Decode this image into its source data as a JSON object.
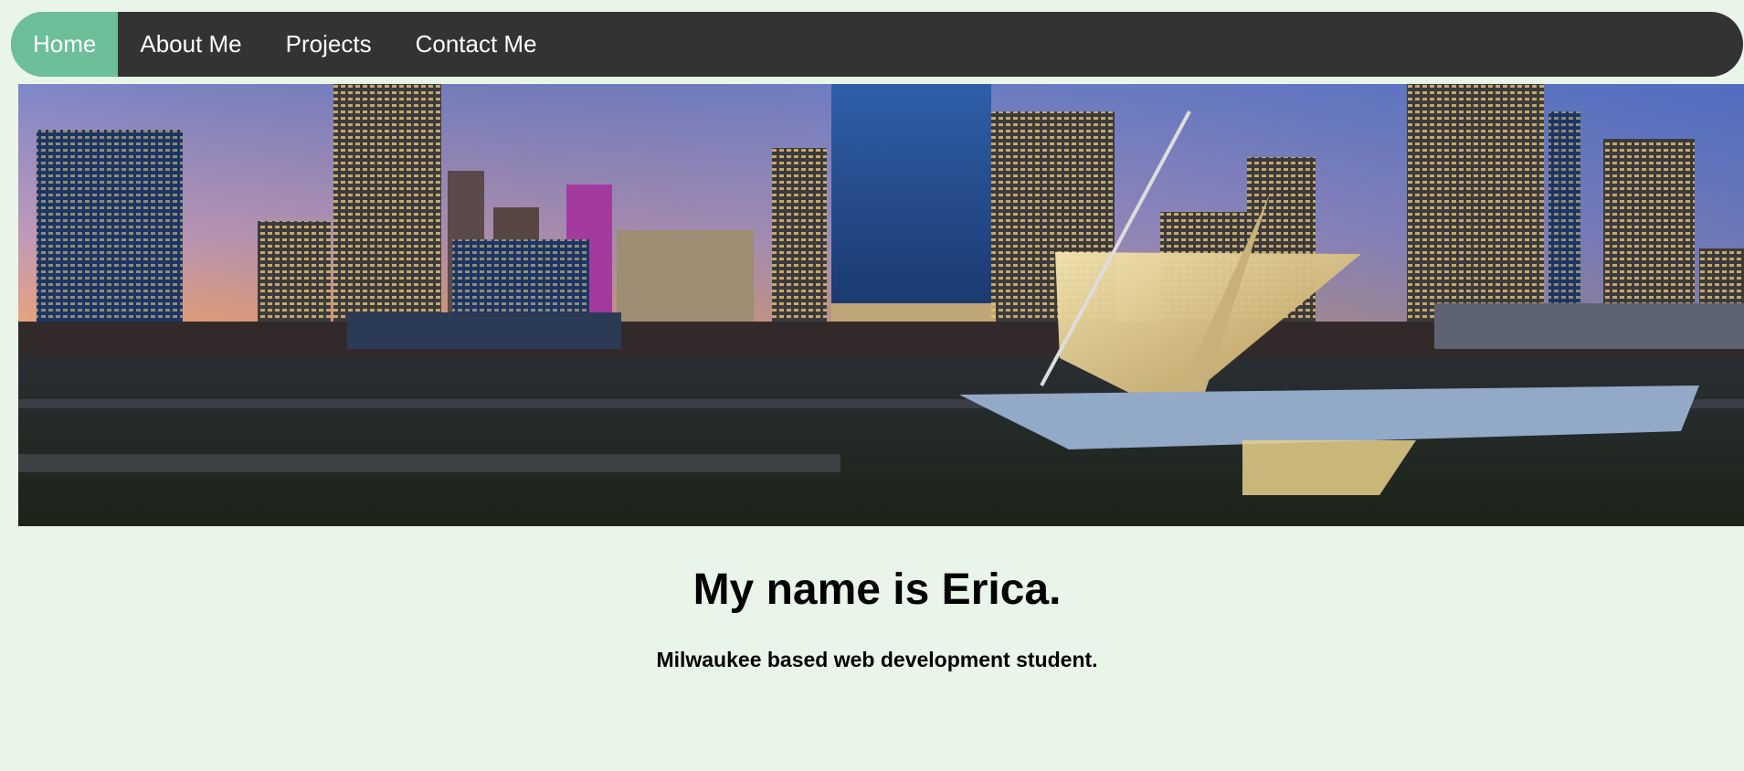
{
  "nav": {
    "items": [
      {
        "label": "Home",
        "active": true
      },
      {
        "label": "About Me",
        "active": false
      },
      {
        "label": "Projects",
        "active": false
      },
      {
        "label": "Contact Me",
        "active": false
      }
    ],
    "active_color": "#6cbf98",
    "bar_color": "#333333"
  },
  "hero": {
    "image_subject": "Milwaukee skyline at dusk with art museum"
  },
  "main": {
    "heading": "My name is Erica.",
    "subheading": "Milwaukee based web development student."
  },
  "colors": {
    "page_background": "#eaf5ea"
  }
}
